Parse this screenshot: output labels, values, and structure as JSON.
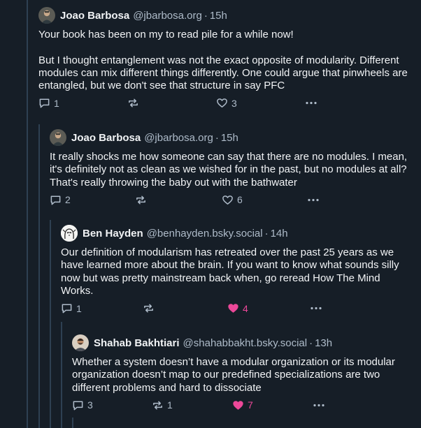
{
  "posts": [
    {
      "author": "Joao Barbosa",
      "handle": "@jbarbosa.org",
      "time": "15h",
      "body": "Your book has been on my to read pile for a while now!\n\nBut I thought entanglement was not the exact opposite of modularity. Different modules can mix different things differently. One could argue that pinwheels are entangled, but we don't see that structure in say PFC",
      "replies": "1",
      "reposts": "",
      "likes": "3",
      "liked": false
    },
    {
      "author": "Joao Barbosa",
      "handle": "@jbarbosa.org",
      "time": "15h",
      "body": "It really shocks me how someone can say that there are no modules. I mean, it's definitely not as clean as we wished for in the past, but no modules at all? That's really throwing the baby out with the bathwater",
      "replies": "2",
      "reposts": "",
      "likes": "6",
      "liked": false
    },
    {
      "author": "Ben Hayden",
      "handle": "@benhayden.bsky.social",
      "time": "14h",
      "body": "Our definition of modularism has retreated over the past 25 years as we have learned more about the brain. If you want to know what sounds silly now but was pretty mainstream back when, go reread How The Mind Works.",
      "replies": "1",
      "reposts": "",
      "likes": "4",
      "liked": true
    },
    {
      "author": "Shahab Bakhtiari",
      "handle": "@shahabbakht.bsky.social",
      "time": "13h",
      "body": "Whether a system doesn’t have a modular organization or its modular organization doesn’t map to our predefined specializations are two different problems and hard to dissociate",
      "replies": "3",
      "reposts": "1",
      "likes": "7",
      "liked": true
    }
  ],
  "icons": {
    "reply": "speech-bubble-icon",
    "repost": "repost-arrows-icon",
    "like": "heart-icon",
    "more": "more-dots-icon"
  },
  "colors": {
    "background": "#161e27",
    "thread_line": "#2e4052",
    "text": "#f1f3f5",
    "muted": "#aebbc9",
    "like_active": "#ec4899"
  }
}
